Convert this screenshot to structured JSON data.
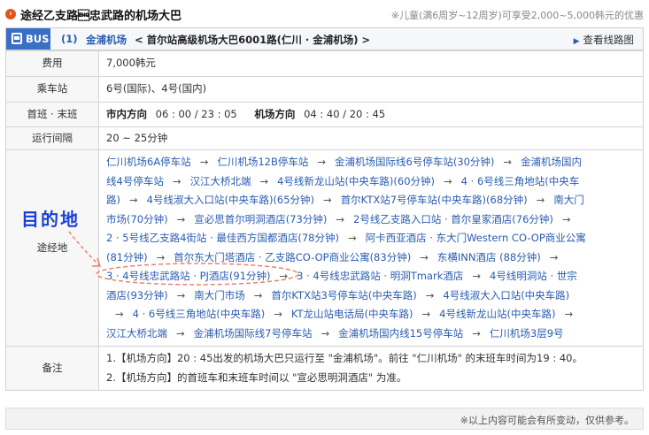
{
  "title": {
    "icon": "chevron-right-icon",
    "text": "途经乙支路\u0005忠武路的机场大巴",
    "note": "※儿童(满6周岁~12周岁)可享受2,000~5,000韩元的优惠"
  },
  "bus_header": {
    "badge": "BUS",
    "route_num": "(1)",
    "airport": "金浦机场",
    "desc": "< 首尔站高级机场大巴6001路(仁川 · 金浦机场) >",
    "link": "查看线路图"
  },
  "rows": {
    "fare": {
      "label": "费用",
      "value": "7,000韩元"
    },
    "stand": {
      "label": "乘车站",
      "value": "6号(国际)、4号(国内)"
    },
    "firstlast": {
      "label": "首班 · 末班",
      "dir1_label": "市内方向",
      "dir1_time": "06 : 00 / 23 : 05",
      "dir2_label": "机场方向",
      "dir2_time": "04 : 40 / 20 : 45"
    },
    "interval": {
      "label": "运行间隔",
      "value": "20 ~ 25分钟"
    },
    "stops": {
      "label": "途经地",
      "lines": [
        "仁川机场6A停车站  →  仁川机场12B停车站  →  金浦机场国际线6号停车站(30分钟)  →  金浦机场国内",
        "线4号停车站  →  汉江大桥北端  →  4号线新龙山站(中央车路)(60分钟)  →  4 · 6号线三角地站(中央车",
        "路)  →  4号线淑大入口站(中央车路)(65分钟)  →  首尔KTX站7号停车站(中央车路)(68分钟)  →  南大门",
        "市场(70分钟)  →  宣必思首尔明洞酒店(73分钟)  →  2号线乙支路入口站 · 首尔皇家酒店(76分钟)  →",
        "2 · 5号线乙支路4街站 · 最佳西方国都酒店(78分钟)  →  阿卡西亚酒店 · 东大门Western CO-OP商业公寓",
        "(81分钟)  →  首尔东大门塔酒店 · 乙支路CO-OP商业公寓(83分钟)  →  东横INN酒店  (88分钟)  →",
        "3 · 4号线忠武路站 · PJ酒店(91分钟)  →  3 · 4号线忠武路站 · 明洞Tmark酒店  →  4号线明洞站 · 世宗",
        "酒店(93分钟)  →  南大门市场  →  首尔KTX站3号停车站(中央车路)  →  4号线淑大入口站(中央车路)",
        "→  4 · 6号线三角地站(中央车路)  →  KT龙山站电话局(中央车路)  →  4号线新龙山站(中央车路)  →",
        "汉江大桥北端  →  金浦机场国际线7号停车站  →  金浦机场国内线15号停车站  →  仁川机场3层9号"
      ]
    },
    "notes": {
      "label": "备注",
      "lines": [
        "1.【机场方向】20 : 45出发的机场大巴只运行至 \"金浦机场\"。前往 \"仁川机场\" 的末班车时间为19 : 40。",
        "2.【机场方向】的首班车和末班车时间以 \"宣必思明洞酒店\" 为准。"
      ]
    }
  },
  "annotation": {
    "label": "目的地"
  },
  "footer": {
    "text": "※以上内容可能会有所变动，仅供参考。"
  },
  "colors": {
    "accent": "#3a70c4",
    "link": "#2a5cb0",
    "annotation": "#1a3fd8",
    "highlight": "#e8836b"
  }
}
